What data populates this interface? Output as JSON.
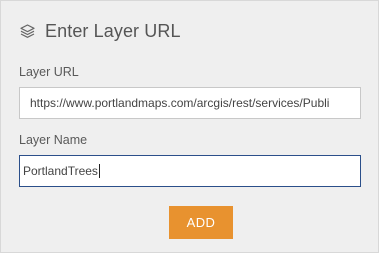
{
  "header": {
    "icon": "layers-icon",
    "title": "Enter Layer URL"
  },
  "form": {
    "layer_url": {
      "label": "Layer URL",
      "value": "https://www.portlandmaps.com/arcgis/rest/services/Publi"
    },
    "layer_name": {
      "label": "Layer Name",
      "value": "PortlandTrees"
    }
  },
  "actions": {
    "add_label": "ADD"
  },
  "colors": {
    "accent": "#e8922f",
    "focus_border": "#2b4f8a",
    "panel_bg": "#efefef"
  }
}
